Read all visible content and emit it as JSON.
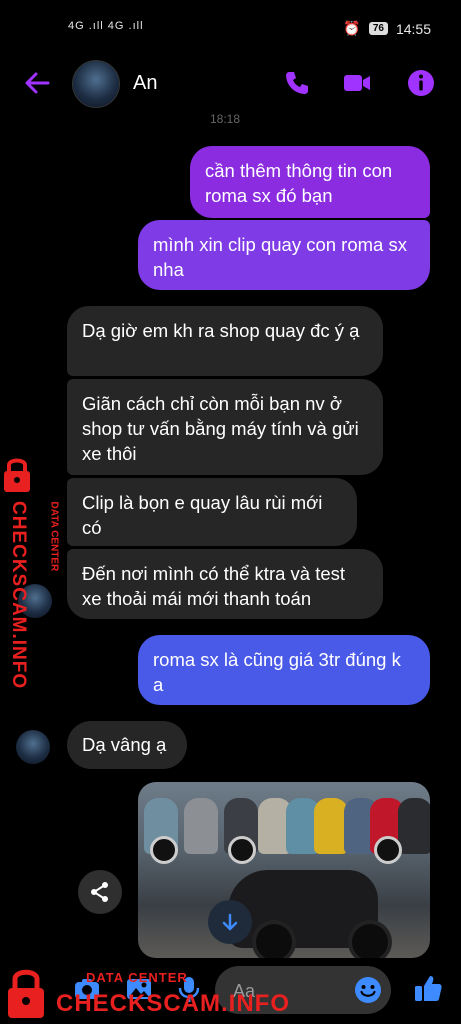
{
  "status_bar": {
    "network": "4G .ıll 4G .ıll",
    "battery": "76",
    "time": "14:55"
  },
  "header": {
    "contact_name": "An"
  },
  "timestamp": "18:18",
  "messages": [
    {
      "side": "out",
      "text": "cần thêm thông tin con roma sx đó bạn"
    },
    {
      "side": "out",
      "text": "mình xin clip quay con roma sx nha"
    },
    {
      "side": "in",
      "text": "Dạ giờ em kh ra shop quay đc ý ạ"
    },
    {
      "side": "in",
      "text": "Giãn cách chỉ còn mỗi bạn nv ở shop tư vấn bằng máy tính và gửi xe thôi"
    },
    {
      "side": "in",
      "text": "Clip là bọn e quay lâu rùi mới có"
    },
    {
      "side": "in",
      "text": "Đến nơi mình có thể ktra và test xe thoải mái mới thanh toán"
    },
    {
      "side": "out",
      "text": "roma sx là cũng giá 3tr đúng k a"
    },
    {
      "side": "in",
      "text": "Dạ vâng ạ"
    }
  ],
  "composer": {
    "placeholder": "Aa"
  },
  "watermark": {
    "side_text": "CHECKSCAM.INFO",
    "side_sub": "DATA CENTER",
    "bottom_title": "DATA CENTER",
    "bottom_big": "CHECKSCAM.INFO"
  },
  "colors": {
    "accent": "#a033ff",
    "outgoing_purple": "#8b2ce0",
    "outgoing_blue": "#4a5ae8",
    "incoming": "#262626",
    "watermark": "#e8201f"
  }
}
